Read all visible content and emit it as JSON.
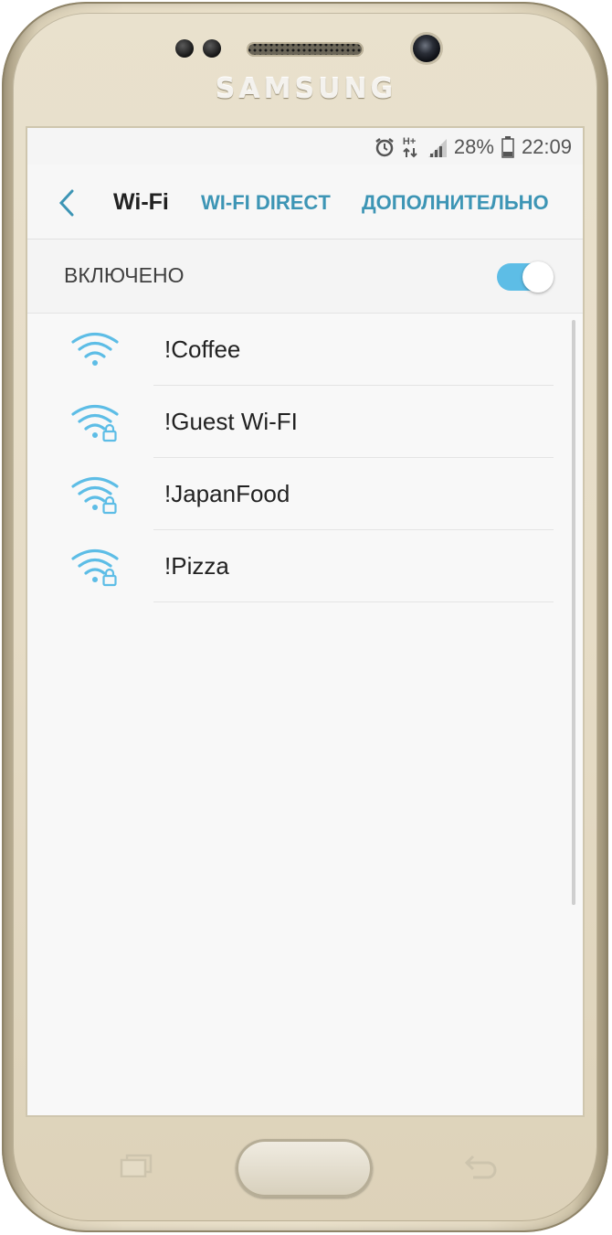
{
  "device": {
    "brand": "SAMSUNG"
  },
  "status_bar": {
    "icons": [
      "alarm-icon",
      "network-hplus-icon",
      "signal-icon",
      "battery-icon"
    ],
    "network_type": "H+",
    "battery": "28%",
    "time": "22:09"
  },
  "app_bar": {
    "back_icon": "chevron-left-icon",
    "title": "Wi-Fi",
    "wifi_direct": "WI-FI DIRECT",
    "advanced": "ДОПОЛНИТЕЛЬНО"
  },
  "wifi_toggle": {
    "label": "ВКЛЮЧЕНО",
    "on": true
  },
  "networks": [
    {
      "name": "!Coffee",
      "secured": false,
      "icon": "wifi-icon"
    },
    {
      "name": "!Guest Wi-FI",
      "secured": true,
      "icon": "wifi-lock-icon"
    },
    {
      "name": "!JapanFood",
      "secured": true,
      "icon": "wifi-lock-icon"
    },
    {
      "name": "!Pizza",
      "secured": true,
      "icon": "wifi-lock-icon"
    }
  ],
  "colors": {
    "accent": "#3d95b5",
    "wifi_icon": "#5dbde6",
    "toggle_on": "#5dbde6",
    "screen_bg": "#f8f8f8"
  }
}
